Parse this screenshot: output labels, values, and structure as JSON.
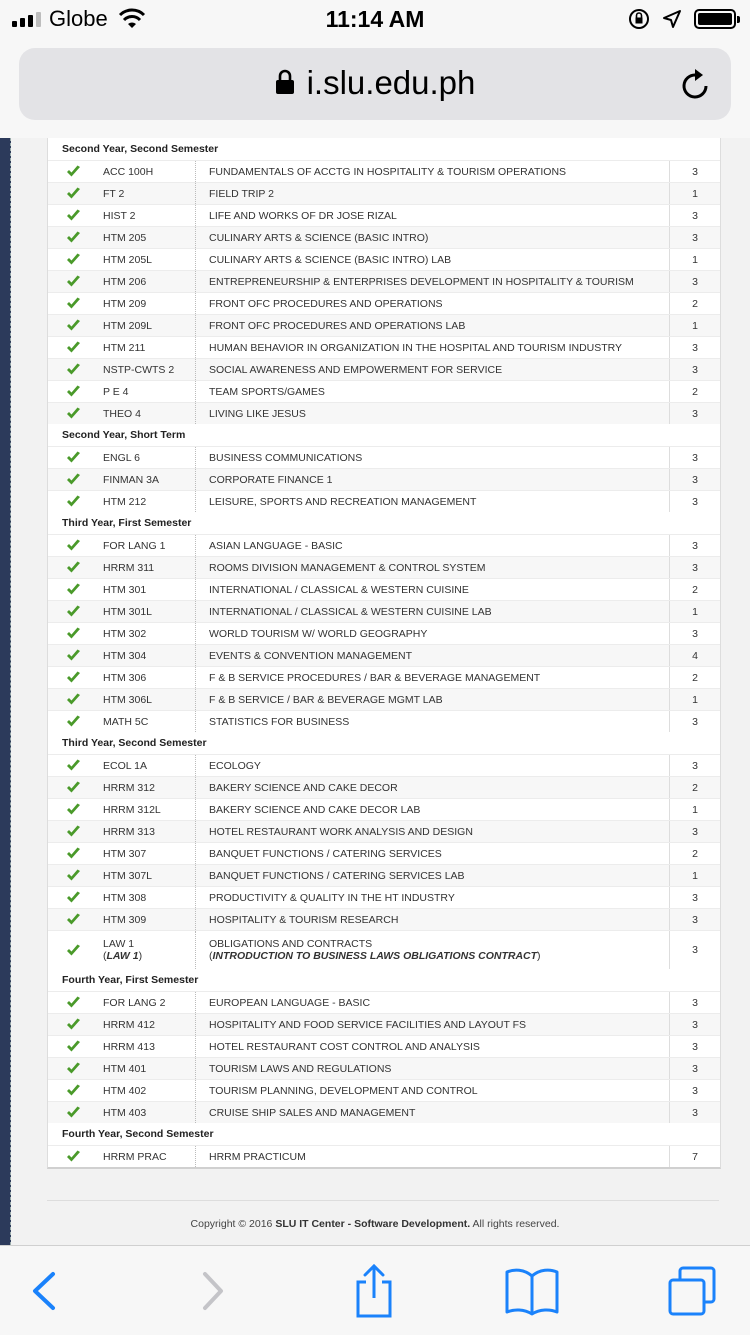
{
  "status": {
    "carrier": "Globe",
    "time": "11:14 AM"
  },
  "browser": {
    "url": "i.slu.edu.ph"
  },
  "colors": {
    "accent": "#1a82fb",
    "check": "#4a9a2a"
  },
  "semesters": [
    {
      "title": "Second Year, Second Semester",
      "courses": [
        {
          "code": "ACC 100H",
          "desc": "FUNDAMENTALS OF ACCTG IN HOSPITALITY & TOURISM OPERATIONS",
          "units": "3"
        },
        {
          "code": "FT 2",
          "desc": "FIELD TRIP 2",
          "units": "1"
        },
        {
          "code": "HIST 2",
          "desc": "LIFE AND WORKS OF DR JOSE RIZAL",
          "units": "3"
        },
        {
          "code": "HTM 205",
          "desc": "CULINARY ARTS & SCIENCE (BASIC INTRO)",
          "units": "3"
        },
        {
          "code": "HTM 205L",
          "desc": "CULINARY ARTS & SCIENCE (BASIC INTRO) LAB",
          "units": "1"
        },
        {
          "code": "HTM 206",
          "desc": "ENTREPRENEURSHIP & ENTERPRISES DEVELOPMENT IN HOSPITALITY & TOURISM",
          "units": "3"
        },
        {
          "code": "HTM 209",
          "desc": "FRONT OFC PROCEDURES AND OPERATIONS",
          "units": "2"
        },
        {
          "code": "HTM 209L",
          "desc": "FRONT OFC PROCEDURES AND OPERATIONS LAB",
          "units": "1"
        },
        {
          "code": "HTM 211",
          "desc": "HUMAN BEHAVIOR IN ORGANIZATION IN THE HOSPITAL AND TOURISM INDUSTRY",
          "units": "3"
        },
        {
          "code": "NSTP-CWTS 2",
          "desc": "SOCIAL AWARENESS AND EMPOWERMENT FOR SERVICE",
          "units": "3"
        },
        {
          "code": "P E 4",
          "desc": "TEAM SPORTS/GAMES",
          "units": "2"
        },
        {
          "code": "THEO 4",
          "desc": "LIVING LIKE JESUS",
          "units": "3"
        }
      ]
    },
    {
      "title": "Second Year, Short Term",
      "courses": [
        {
          "code": "ENGL 6",
          "desc": "BUSINESS COMMUNICATIONS",
          "units": "3"
        },
        {
          "code": "FINMAN 3A",
          "desc": "CORPORATE FINANCE 1",
          "units": "3"
        },
        {
          "code": "HTM 212",
          "desc": "LEISURE, SPORTS AND RECREATION MANAGEMENT",
          "units": "3"
        }
      ]
    },
    {
      "title": "Third Year, First Semester",
      "courses": [
        {
          "code": "FOR LANG 1",
          "desc": "ASIAN LANGUAGE - BASIC",
          "units": "3"
        },
        {
          "code": "HRRM 311",
          "desc": "ROOMS DIVISION MANAGEMENT & CONTROL SYSTEM",
          "units": "3"
        },
        {
          "code": "HTM 301",
          "desc": "INTERNATIONAL / CLASSICAL & WESTERN CUISINE",
          "units": "2"
        },
        {
          "code": "HTM 301L",
          "desc": "INTERNATIONAL / CLASSICAL & WESTERN CUISINE LAB",
          "units": "1"
        },
        {
          "code": "HTM 302",
          "desc": "WORLD TOURISM W/ WORLD GEOGRAPHY",
          "units": "3"
        },
        {
          "code": "HTM 304",
          "desc": "EVENTS & CONVENTION MANAGEMENT",
          "units": "4"
        },
        {
          "code": "HTM 306",
          "desc": "F & B SERVICE PROCEDURES / BAR & BEVERAGE MANAGEMENT",
          "units": "2"
        },
        {
          "code": "HTM 306L",
          "desc": "F & B SERVICE / BAR & BEVERAGE MGMT LAB",
          "units": "1"
        },
        {
          "code": "MATH 5C",
          "desc": "STATISTICS FOR BUSINESS",
          "units": "3"
        }
      ]
    },
    {
      "title": "Third Year, Second Semester",
      "courses": [
        {
          "code": "ECOL 1A",
          "desc": "ECOLOGY",
          "units": "3"
        },
        {
          "code": "HRRM 312",
          "desc": "BAKERY SCIENCE AND CAKE DECOR",
          "units": "2"
        },
        {
          "code": "HRRM 312L",
          "desc": "BAKERY SCIENCE AND CAKE DECOR LAB",
          "units": "1"
        },
        {
          "code": "HRRM 313",
          "desc": "HOTEL RESTAURANT WORK ANALYSIS AND DESIGN",
          "units": "3"
        },
        {
          "code": "HTM 307",
          "desc": "BANQUET FUNCTIONS / CATERING SERVICES",
          "units": "2"
        },
        {
          "code": "HTM 307L",
          "desc": "BANQUET FUNCTIONS / CATERING SERVICES LAB",
          "units": "1"
        },
        {
          "code": "HTM 308",
          "desc": "PRODUCTIVITY & QUALITY IN THE HT INDUSTRY",
          "units": "3"
        },
        {
          "code": "HTM 309",
          "desc": "HOSPITALITY & TOURISM RESEARCH",
          "units": "3"
        },
        {
          "code": "LAW 1",
          "code2": "LAW 1",
          "desc": "OBLIGATIONS AND CONTRACTS",
          "desc2": "INTRODUCTION TO BUSINESS LAWS OBLIGATIONS CONTRACT",
          "units": "3"
        }
      ]
    },
    {
      "title": "Fourth Year, First Semester",
      "courses": [
        {
          "code": "FOR LANG 2",
          "desc": "EUROPEAN LANGUAGE - BASIC",
          "units": "3"
        },
        {
          "code": "HRRM 412",
          "desc": "HOSPITALITY AND FOOD SERVICE FACILITIES AND LAYOUT FS",
          "units": "3"
        },
        {
          "code": "HRRM 413",
          "desc": "HOTEL RESTAURANT COST CONTROL AND ANALYSIS",
          "units": "3"
        },
        {
          "code": "HTM 401",
          "desc": "TOURISM LAWS AND REGULATIONS",
          "units": "3"
        },
        {
          "code": "HTM 402",
          "desc": "TOURISM PLANNING, DEVELOPMENT AND CONTROL",
          "units": "3"
        },
        {
          "code": "HTM 403",
          "desc": "CRUISE SHIP SALES AND MANAGEMENT",
          "units": "3"
        }
      ]
    },
    {
      "title": "Fourth Year, Second Semester",
      "courses": [
        {
          "code": "HRRM PRAC",
          "desc": "HRRM PRACTICUM",
          "units": "7"
        }
      ]
    }
  ],
  "footer": {
    "prefix": "Copyright © 2016 ",
    "org": "SLU IT Center - Software Development.",
    "suffix": " All rights reserved."
  }
}
